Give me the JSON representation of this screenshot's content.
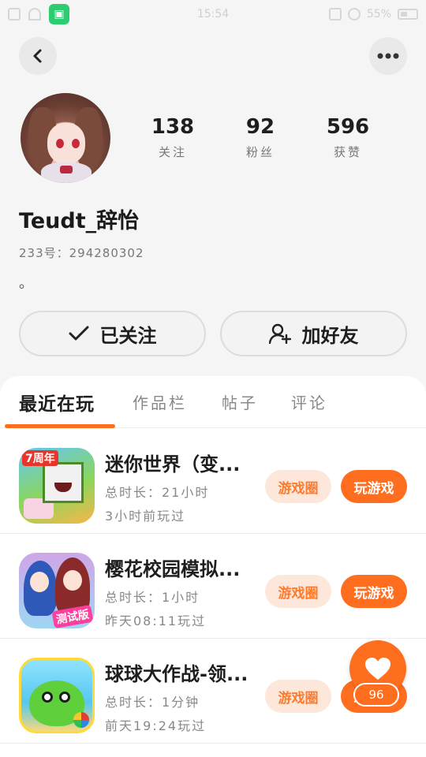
{
  "status_bar": {
    "time": "15:54",
    "battery": "55%"
  },
  "profile": {
    "following_count": "138",
    "following_label": "关注",
    "fans_count": "92",
    "fans_label": "粉丝",
    "likes_count": "596",
    "likes_label": "获赞",
    "username": "Teudt_辞怡",
    "uid": "233号：294280302",
    "bio": "。"
  },
  "actions": {
    "followed_label": "已关注",
    "add_friend_label": "加好友"
  },
  "tabs": [
    {
      "label": "最近在玩",
      "active": true
    },
    {
      "label": "作品栏",
      "active": false
    },
    {
      "label": "帖子",
      "active": false
    },
    {
      "label": "评论",
      "active": false
    }
  ],
  "games": [
    {
      "title": "迷你世界（变...",
      "duration": "总时长：21小时",
      "last_played": "3小时前玩过",
      "icon_badge": "7周年",
      "circle_label": "游戏圈",
      "play_label": "玩游戏"
    },
    {
      "title": "樱花校园模拟...",
      "duration": "总时长：1小时",
      "last_played": "昨天08:11玩过",
      "icon_badge": "测试版",
      "circle_label": "游戏圈",
      "play_label": "玩游戏"
    },
    {
      "title": "球球大作战-领...",
      "duration": "总时长：1分钟",
      "last_played": "前天19:24玩过",
      "circle_label": "游戏圈",
      "play_label": "玩游戏"
    }
  ],
  "floating_like": {
    "count": "96",
    "icon": "heart-icon"
  },
  "colors": {
    "accent": "#ff6d1f",
    "accent_light": "#fde7da",
    "background": "#f5f5f5"
  }
}
